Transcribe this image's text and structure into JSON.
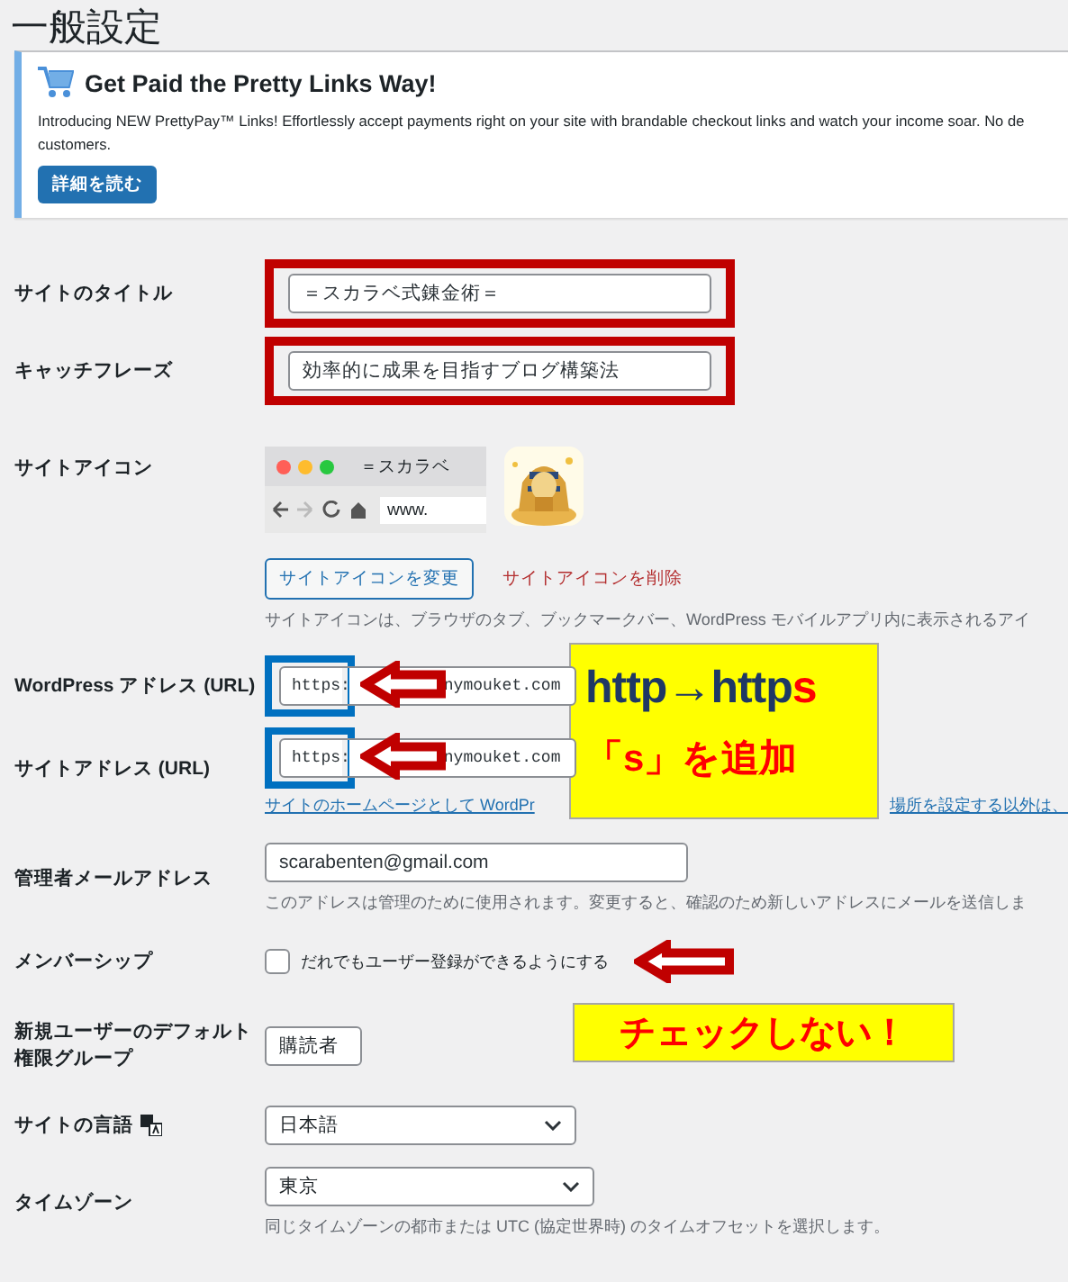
{
  "page_title": "一般設定",
  "notice": {
    "heading": "Get Paid the Pretty Links Way!",
    "lines": [
      "Introducing NEW PrettyPay™ Links! Effortlessly accept payments right on your site with brandable checkout links and watch your income soar. No de",
      "customers."
    ],
    "button": "詳細を読む"
  },
  "settings": [
    {
      "kind": "text",
      "label": "サイトのタイトル",
      "value": "＝スカラベ式錬金術＝",
      "highlighted": true
    },
    {
      "kind": "text",
      "label": "キャッチフレーズ",
      "value": "効率的に成果を目指すブログ構築法",
      "highlighted": true
    },
    {
      "kind": "site_icon",
      "label": "サイトアイコン",
      "tab_title": "＝スカラベ",
      "address": "www.",
      "change_button": "サイトアイコンを変更",
      "remove_link": "サイトアイコンを削除",
      "description": "サイトアイコンは、ブラウザのタブ、ブックマークバー、WordPress モバイルアプリ内に表示されるアイ"
    },
    {
      "kind": "url",
      "label": "WordPress アドレス (URL)",
      "value_parts": [
        "https:",
        "nymouket.com"
      ],
      "highlighted": true
    },
    {
      "kind": "url",
      "label": "サイトアドレス (URL)",
      "value_parts": [
        "https:",
        "nymouket.com"
      ],
      "highlighted": true,
      "description_parts": [
        "サイトのホームページとして WordPr",
        "場所を設定する以外は、"
      ]
    },
    {
      "kind": "email",
      "label": "管理者メールアドレス",
      "value": "scarabenten@gmail.com",
      "description": "このアドレスは管理のために使用されます。変更すると、確認のため新しいアドレスにメールを送信しま"
    },
    {
      "kind": "checkbox",
      "label": "メンバーシップ",
      "option": "だれでもユーザー登録ができるようにする",
      "checked": false,
      "pointed": true
    },
    {
      "kind": "select",
      "label": "新規ユーザーのデフォルト権限グループ",
      "value": "購読者"
    },
    {
      "kind": "language",
      "label": "サイトの言語",
      "value": "日本語"
    },
    {
      "kind": "timezone",
      "label": "タイムゾーン",
      "value": "東京",
      "description": "同じタイムゾーンの都市または UTC (協定世界時) のタイムオフセットを選択します。"
    }
  ],
  "callouts": [
    {
      "kind": "url_note",
      "title_parts": [
        {
          "text": "http→http",
          "color": "#1f3864"
        },
        {
          "text": "s",
          "color": "#ff0000"
        }
      ],
      "subtitle": "「s」を追加"
    },
    {
      "kind": "checkbox_note",
      "text": "チェックしない！"
    }
  ]
}
